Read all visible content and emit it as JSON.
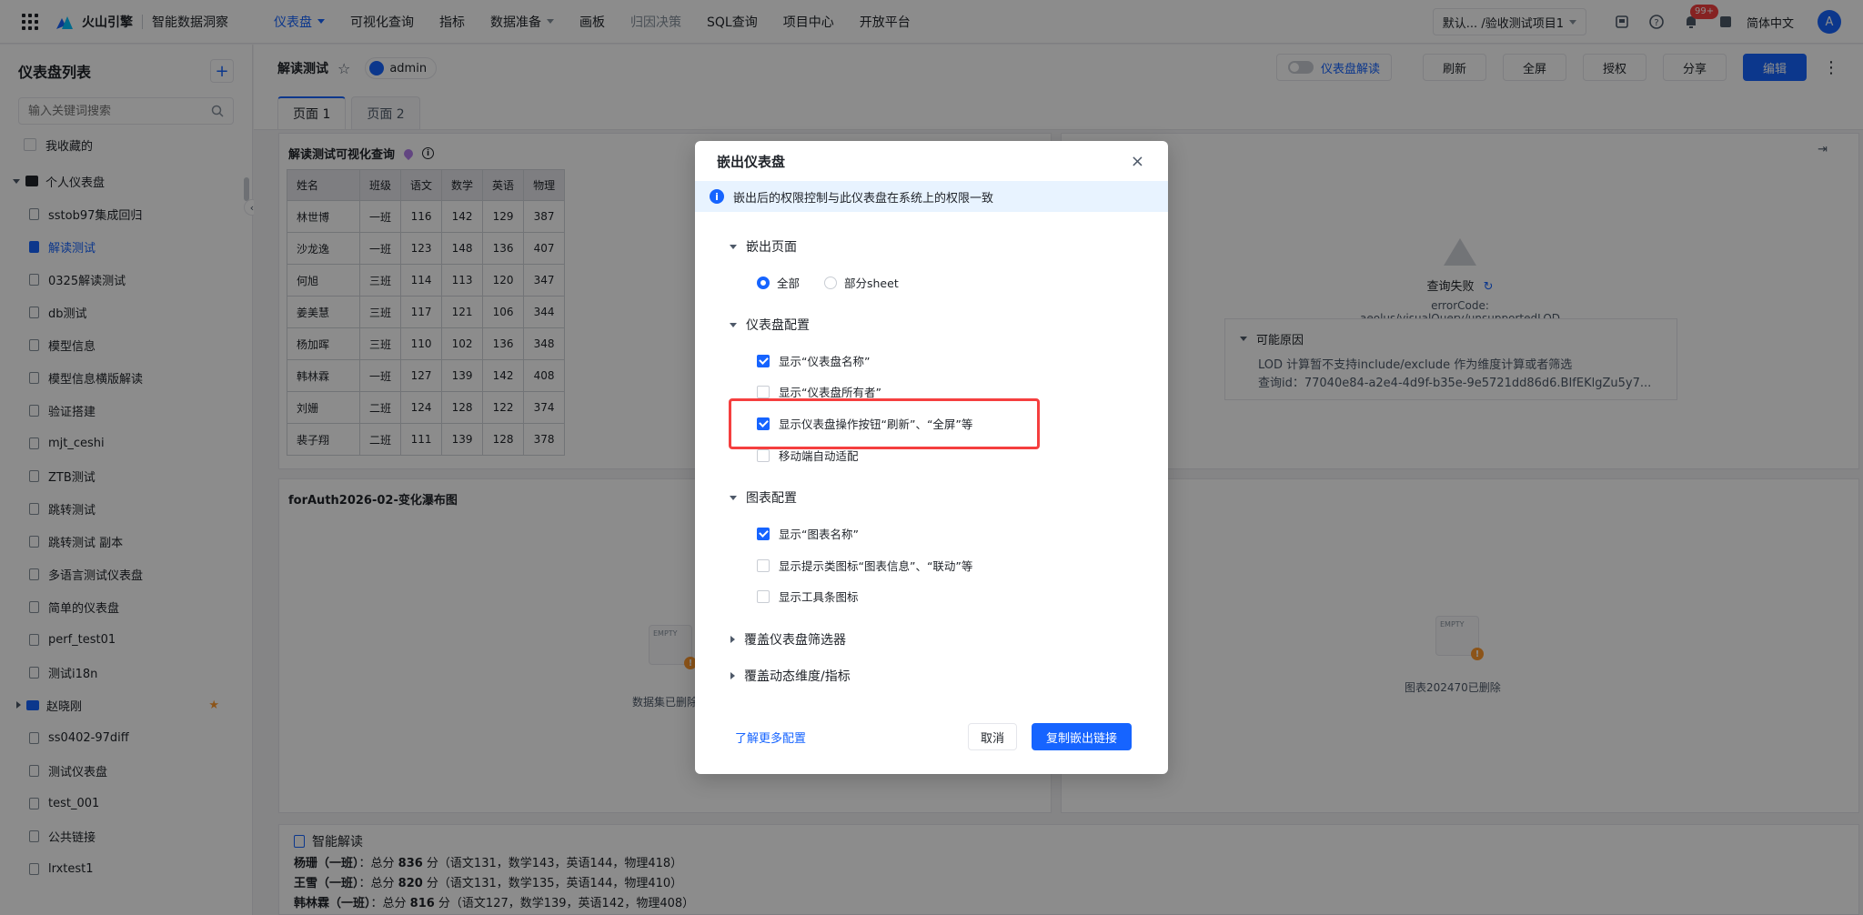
{
  "topbar": {
    "brand": "火山引擎",
    "product": "智能数据洞察",
    "nav": [
      {
        "label": "仪表盘",
        "active": true,
        "caret": true
      },
      {
        "label": "可视化查询"
      },
      {
        "label": "指标"
      },
      {
        "label": "数据准备",
        "caret": true
      },
      {
        "label": "画板"
      },
      {
        "label": "归因决策",
        "disabled": true
      },
      {
        "label": "SQL查询"
      },
      {
        "label": "项目中心"
      },
      {
        "label": "开放平台"
      }
    ],
    "project": "默认... /验收测试项目1",
    "badge": "99+",
    "language": "简体中文",
    "avatar": "A"
  },
  "sidebar": {
    "title": "仪表盘列表",
    "search_placeholder": "输入关键词搜索",
    "favorites": "我收藏的",
    "root": "个人仪表盘",
    "items": [
      {
        "label": "sstob97集成回归"
      },
      {
        "label": "解读测试",
        "active": true
      },
      {
        "label": "0325解读测试"
      },
      {
        "label": "db测试"
      },
      {
        "label": "模型信息"
      },
      {
        "label": "模型信息横版解读"
      },
      {
        "label": "验证搭建"
      },
      {
        "label": "mjt_ceshi"
      },
      {
        "label": "ZTB测试"
      },
      {
        "label": "跳转测试"
      },
      {
        "label": "跳转测试 副本"
      },
      {
        "label": "多语言测试仪表盘"
      },
      {
        "label": "简单的仪表盘"
      },
      {
        "label": "perf_test01"
      },
      {
        "label": "测试i18n"
      },
      {
        "label": "赵晓刚",
        "folder": true
      },
      {
        "label": "ss0402-97diff"
      },
      {
        "label": "测试仪表盘"
      },
      {
        "label": "test_001"
      },
      {
        "label": "公共链接"
      },
      {
        "label": "lrxtest1"
      }
    ]
  },
  "header": {
    "title": "解读测试",
    "owner": "admin",
    "toggle_label": "仪表盘解读",
    "buttons": [
      "刷新",
      "全屏",
      "授权",
      "分享"
    ],
    "edit": "编辑",
    "tabs": [
      "页面 1",
      "页面 2"
    ]
  },
  "table_card": {
    "title": "解读测试可视化查询",
    "headers": [
      "姓名",
      "班级",
      "语文",
      "数学",
      "英语",
      "物理"
    ],
    "rows": [
      [
        "林世博",
        "一班",
        "116",
        "142",
        "129",
        "387"
      ],
      [
        "沙龙逸",
        "一班",
        "123",
        "148",
        "136",
        "407"
      ],
      [
        "何旭",
        "三班",
        "114",
        "113",
        "120",
        "347"
      ],
      [
        "姜美慧",
        "三班",
        "117",
        "121",
        "106",
        "344"
      ],
      [
        "杨加晖",
        "三班",
        "110",
        "102",
        "136",
        "348"
      ],
      [
        "韩林霖",
        "一班",
        "127",
        "139",
        "142",
        "408"
      ],
      [
        "刘姗",
        "二班",
        "124",
        "128",
        "122",
        "374"
      ],
      [
        "裴子翔",
        "二班",
        "111",
        "139",
        "128",
        "378"
      ]
    ]
  },
  "error_card": {
    "title": "查询失败",
    "code": "errorCode: aeolus/visualQuery/unsupportedLOD",
    "reason_title": "可能原因",
    "reason_lines": [
      "LOD 计算暂不支持include/exclude 作为维度计算或者筛选",
      "查询id：77040e84-a2e4-4d9f-b35e-9e5721dd86d6.BIfEKlgZu5y7..."
    ]
  },
  "waterfall_card": {
    "title": "forAuth2026-02-变化瀑布图",
    "empty_text": "数据集已删除",
    "ill_text": "EMPTY"
  },
  "right_card": {
    "empty_text": "图表202470已删除",
    "ill_text": "EMPTY"
  },
  "ai": {
    "title": "智能解读",
    "lines": [
      {
        "name": "杨珊（一班）",
        "pre": "：总分 ",
        "score": "836",
        "post": " 分（语文131，数学143，英语144，物理418）"
      },
      {
        "name": "王雪（一班）",
        "pre": "：总分 ",
        "score": "820",
        "post": " 分（语文131，数学135，英语144，物理410）"
      },
      {
        "name": "韩林霖（一班）",
        "pre": "：总分 ",
        "score": "816",
        "post": " 分（语文127，数学139，英语142，物理408）"
      }
    ]
  },
  "modal": {
    "title": "嵌出仪表盘",
    "close": "×",
    "notice": "嵌出后的权限控制与此仪表盘在系统上的权限一致",
    "section_page": "嵌出页面",
    "radio_all": "全部",
    "radio_part": "部分sheet",
    "section_dashboard": "仪表盘配置",
    "opt_show_name": "显示“仪表盘名称”",
    "opt_show_owner": "显示“仪表盘所有者”",
    "opt_show_actions": "显示仪表盘操作按钮“刷新”、“全屏”等",
    "opt_mobile": "移动端自动适配",
    "section_chart": "图表配置",
    "opt_chart_name": "显示“图表名称”",
    "opt_chart_tips": "显示提示类图标“图表信息”、“联动”等",
    "opt_toolbar": "显示工具条图标",
    "section_filter": "覆盖仪表盘筛选器",
    "section_dynamic": "覆盖动态维度/指标",
    "learn_more": "了解更多配置",
    "cancel": "取消",
    "copy": "复制嵌出链接"
  }
}
